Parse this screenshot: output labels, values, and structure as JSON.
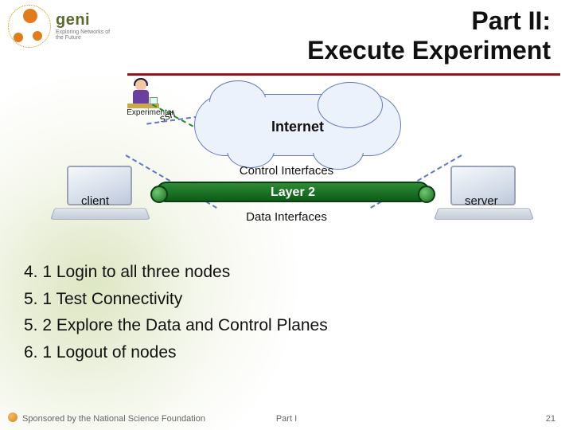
{
  "logo": {
    "brand": "geni",
    "tagline": "Exploring Networks of the Future"
  },
  "title": {
    "line1": "Part II:",
    "line2": "Execute Experiment"
  },
  "diagram": {
    "experimenter_label": "Experimenter",
    "ssh_label": "ssh",
    "cloud_label": "Internet",
    "control_label": "Control Interfaces",
    "layer2_label": "Layer 2",
    "data_label": "Data Interfaces",
    "client_label": "client",
    "server_label": "server"
  },
  "steps": [
    "4. 1 Login to all three nodes",
    "5. 1 Test Connectivity",
    "5. 2 Explore the Data and Control Planes",
    "6. 1 Logout of nodes"
  ],
  "footer": {
    "left": "Sponsored by the National Science Foundation",
    "center": "Part I",
    "right": "21"
  }
}
